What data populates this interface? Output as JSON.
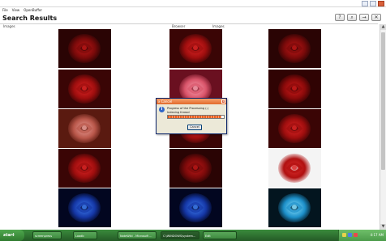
{
  "menu": [
    "File",
    "View",
    "OpenBuffer"
  ],
  "heading": "Search Results",
  "toolbar": [
    "?",
    "⌕",
    "→",
    "✕"
  ],
  "columns": {
    "left": "Images",
    "middle": "Browser",
    "right": "Images"
  },
  "images": [
    {
      "tone": "red-dark"
    },
    {
      "tone": "red"
    },
    {
      "tone": "red-dark"
    },
    {
      "tone": "red"
    },
    {
      "tone": "pink"
    },
    {
      "tone": "red-bunch"
    },
    {
      "tone": "salmon"
    },
    {
      "tone": "red"
    },
    {
      "tone": "red"
    },
    {
      "tone": "red"
    },
    {
      "tone": "red-dark"
    },
    {
      "tone": "red-on-white"
    },
    {
      "tone": "blue"
    },
    {
      "tone": "blue"
    },
    {
      "tone": "cyan"
    }
  ],
  "dialog": {
    "title": "x Cancel",
    "message": "Progress of the Processing (-)",
    "status": "Indexing thread",
    "progress": 0.95,
    "button": "Cancel"
  },
  "taskbar": {
    "start": "start",
    "tasks": [
      "screenpress",
      "Loadb",
      "NoteWiki - Microsoft ...",
      "C:\\WINDOWS\\system...",
      "Edit"
    ],
    "clock": "4:17 AM"
  },
  "colors": {
    "accent": "#2d6e2f",
    "dialog_title": "#e26a2c",
    "progress": "#e85c1e"
  }
}
